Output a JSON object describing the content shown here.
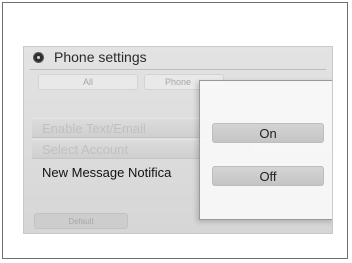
{
  "header": {
    "title": "Phone settings",
    "icon": "gear-icon"
  },
  "tabs": [
    {
      "label": "All"
    },
    {
      "label": "Phone"
    }
  ],
  "settings": {
    "rows": [
      {
        "label": "Enable Text/Email"
      },
      {
        "label": "Select Account"
      },
      {
        "label": "New Message Notifica"
      }
    ]
  },
  "footer": {
    "button_label": "Default"
  },
  "popup": {
    "options": [
      {
        "label": "On"
      },
      {
        "label": "Off"
      }
    ]
  },
  "colors": {
    "screen_bg": "#dcdcdc",
    "popup_bg": "#f8f8f8",
    "text_dark": "#111111",
    "text_muted": "#c0c0c0"
  }
}
